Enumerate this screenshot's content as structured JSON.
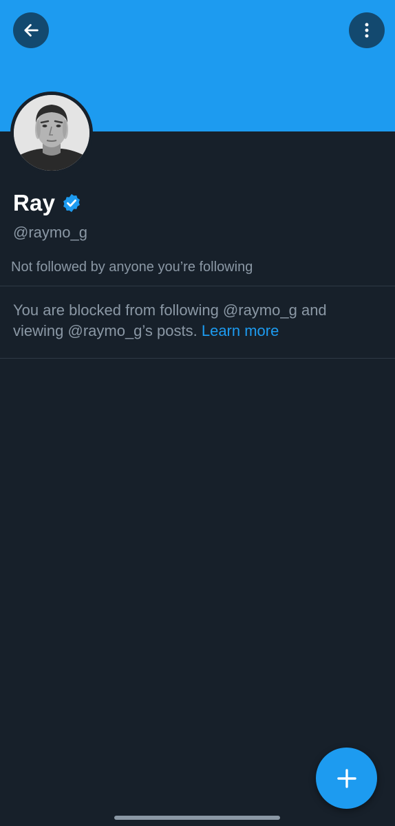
{
  "header": {
    "back_icon": "arrow-left-icon",
    "more_icon": "more-vertical-icon",
    "banner_color": "#1d9bf0"
  },
  "profile": {
    "name": "Ray",
    "verified": true,
    "verified_icon": "verified-badge-icon",
    "handle": "@raymo_g",
    "followers_note": "Not followed by anyone you’re following"
  },
  "blocked_notice": {
    "text": "You are blocked from following @raymo_g and viewing @raymo_g’s posts.",
    "link_label": "Learn more"
  },
  "fab": {
    "icon": "plus-icon",
    "color": "#1d9bf0"
  }
}
